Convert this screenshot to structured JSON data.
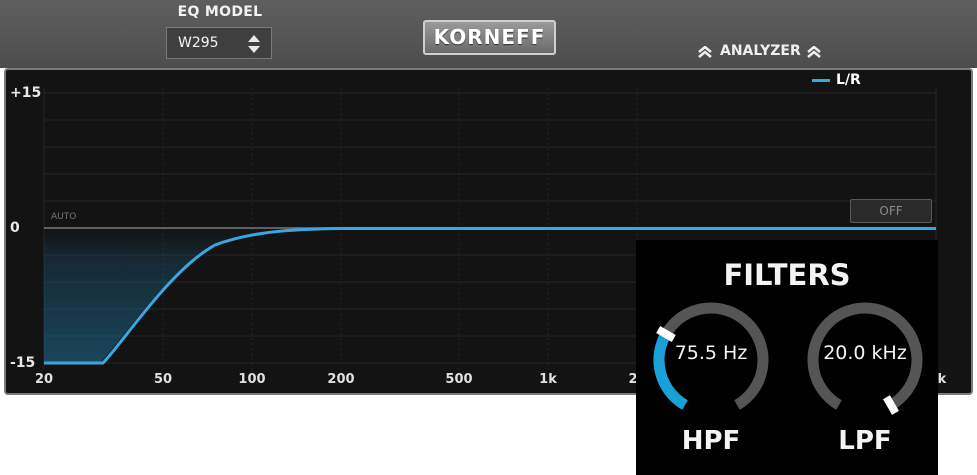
{
  "header": {
    "eq_model_label": "EQ MODEL",
    "eq_model_value": "W295",
    "logo_text": "KORNEFF",
    "analyzer_label": "ANALYZER"
  },
  "graph": {
    "legend_label": "L/R",
    "auto_label": "AUTO",
    "off_label": "OFF",
    "y_ticks": [
      "+15",
      "0",
      "-15"
    ],
    "x_ticks": [
      "20",
      "50",
      "100",
      "200",
      "500",
      "1k",
      "2",
      "k"
    ],
    "curve_color": "#3aa8e0"
  },
  "filters": {
    "title": "FILTERS",
    "hpf_value": "75.5 Hz",
    "hpf_label": "HPF",
    "lpf_value": "20.0 kHz",
    "lpf_label": "LPF",
    "hpf_level": 0.3,
    "lpf_level": 1.0,
    "accent": "#1aa0d8"
  }
}
